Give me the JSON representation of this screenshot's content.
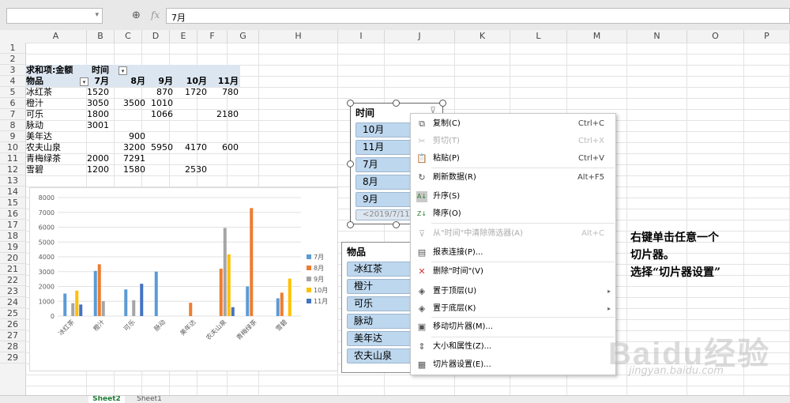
{
  "formula_bar": {
    "zoom_icon": "zoom-icon",
    "fx_label": "fx",
    "value": "7月"
  },
  "columns": [
    "A",
    "B",
    "C",
    "D",
    "E",
    "F",
    "G",
    "H",
    "I",
    "J",
    "K",
    "L",
    "M",
    "N",
    "O",
    "P"
  ],
  "rows": [
    "1",
    "2",
    "3",
    "4",
    "5",
    "6",
    "7",
    "8",
    "9",
    "10",
    "11",
    "12",
    "13",
    "14",
    "15",
    "16",
    "17",
    "18",
    "19",
    "20",
    "21",
    "22",
    "23",
    "24",
    "25",
    "26",
    "27",
    "28",
    "29"
  ],
  "pivot": {
    "header": "求和项:金额",
    "col_field": "时间",
    "row_field": "物品",
    "months": [
      "7月",
      "8月",
      "9月",
      "10月",
      "11月"
    ],
    "rows": [
      {
        "name": "冰红茶",
        "v": [
          "1520",
          "",
          "870",
          "1720",
          "780"
        ]
      },
      {
        "name": "橙汁",
        "v": [
          "3050",
          "3500",
          "1010",
          "",
          ""
        ]
      },
      {
        "name": "可乐",
        "v": [
          "1800",
          "",
          "1066",
          "",
          "2180"
        ]
      },
      {
        "name": "脉动",
        "v": [
          "3001",
          "",
          "",
          "",
          ""
        ]
      },
      {
        "name": "美年达",
        "v": [
          "",
          "900",
          "",
          "",
          ""
        ]
      },
      {
        "name": "农夫山泉",
        "v": [
          "",
          "3200",
          "5950",
          "4170",
          "600"
        ]
      },
      {
        "name": "青梅绿茶",
        "v": [
          "2000",
          "7291",
          "",
          "",
          ""
        ]
      },
      {
        "name": "雪碧",
        "v": [
          "1200",
          "1580",
          "",
          "2530",
          ""
        ]
      }
    ]
  },
  "chart_data": {
    "type": "bar",
    "categories": [
      "冰红茶",
      "橙汁",
      "可乐",
      "脉动",
      "美年达",
      "农夫山泉",
      "青梅绿茶",
      "雪碧"
    ],
    "series": [
      {
        "name": "7月",
        "color": "#5b9bd5",
        "values": [
          1520,
          3050,
          1800,
          3001,
          0,
          0,
          2000,
          1200
        ]
      },
      {
        "name": "8月",
        "color": "#ed7d31",
        "values": [
          0,
          3500,
          0,
          0,
          900,
          3200,
          7291,
          1580
        ]
      },
      {
        "name": "9月",
        "color": "#a5a5a5",
        "values": [
          870,
          1010,
          1066,
          0,
          0,
          5950,
          0,
          0
        ]
      },
      {
        "name": "10月",
        "color": "#ffc000",
        "values": [
          1720,
          0,
          0,
          0,
          0,
          4170,
          0,
          2530
        ]
      },
      {
        "name": "11月",
        "color": "#4472c4",
        "values": [
          780,
          0,
          2180,
          0,
          0,
          600,
          0,
          0
        ]
      }
    ],
    "yticks": [
      "0",
      "1000",
      "2000",
      "3000",
      "4000",
      "5000",
      "6000",
      "7000",
      "8000"
    ],
    "ylim": [
      0,
      8000
    ],
    "legend_position": "right",
    "grid": true
  },
  "slicer_time": {
    "title": "时间",
    "items": [
      "10月",
      "11月",
      "7月",
      "8月",
      "9月"
    ],
    "partial": "<2019/7/11"
  },
  "slicer_goods": {
    "title": "物品",
    "items": [
      "冰红茶",
      "橙汁",
      "可乐",
      "脉动",
      "美年达",
      "农夫山泉"
    ]
  },
  "menu": [
    {
      "icon": "copy-icon",
      "glyph": "⧉",
      "label": "复制(C)",
      "shortcut": "Ctrl+C",
      "enabled": true
    },
    {
      "icon": "cut-icon",
      "glyph": "✂",
      "label": "剪切(T)",
      "shortcut": "Ctrl+X",
      "enabled": false
    },
    {
      "icon": "paste-icon",
      "glyph": "📋",
      "label": "粘贴(P)",
      "shortcut": "Ctrl+V",
      "enabled": true
    },
    {
      "icon": "refresh-icon",
      "glyph": "↻",
      "label": "刷新数据(R)",
      "shortcut": "Alt+F5",
      "enabled": true
    },
    {
      "icon": "sort-asc-icon",
      "glyph": "A↓",
      "label": "升序(S)",
      "shortcut": "",
      "enabled": true
    },
    {
      "icon": "sort-desc-icon",
      "glyph": "Z↓",
      "label": "降序(O)",
      "shortcut": "",
      "enabled": true
    },
    {
      "icon": "clear-filter-icon",
      "glyph": "⊽",
      "label": "从\"时间\"中清除筛选器(A)",
      "shortcut": "Alt+C",
      "enabled": false
    },
    {
      "icon": "report-connection-icon",
      "glyph": "▤",
      "label": "报表连接(P)...",
      "shortcut": "",
      "enabled": true
    },
    {
      "icon": "delete-icon",
      "glyph": "✕",
      "label": "删除\"时间\"(V)",
      "shortcut": "",
      "enabled": true
    },
    {
      "icon": "bring-front-icon",
      "glyph": "◈",
      "label": "置于顶层(U)",
      "shortcut": "",
      "enabled": true,
      "submenu": true
    },
    {
      "icon": "send-back-icon",
      "glyph": "◈",
      "label": "置于底层(K)",
      "shortcut": "",
      "enabled": true,
      "submenu": true
    },
    {
      "icon": "move-slicer-icon",
      "glyph": "▣",
      "label": "移动切片器(M)...",
      "shortcut": "",
      "enabled": true
    },
    {
      "icon": "size-props-icon",
      "glyph": "⇕",
      "label": "大小和属性(Z)...",
      "shortcut": "",
      "enabled": true
    },
    {
      "icon": "slicer-settings-icon",
      "glyph": "▦",
      "label": "切片器设置(E)...",
      "shortcut": "",
      "enabled": true
    }
  ],
  "annotation": [
    "右键单击任意一个",
    "切片器。",
    "选择“切片器设置”"
  ],
  "watermark": {
    "text": "Baidu经验",
    "url": "jingyan.baidu.com"
  },
  "sheets": [
    "Sheet2",
    "Sheet1"
  ]
}
